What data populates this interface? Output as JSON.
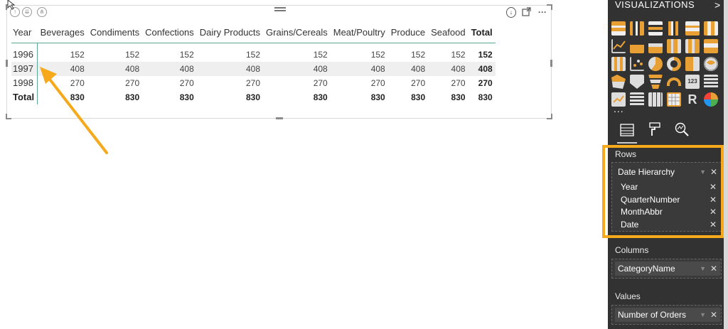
{
  "matrix": {
    "row_header": "Year",
    "columns": [
      "Beverages",
      "Condiments",
      "Confections",
      "Dairy Products",
      "Grains/Cereals",
      "Meat/Poultry",
      "Produce",
      "Seafood"
    ],
    "total_label": "Total",
    "rows": [
      {
        "year": "1996",
        "values": [
          "152",
          "152",
          "152",
          "152",
          "152",
          "152",
          "152",
          "152"
        ],
        "total": "152"
      },
      {
        "year": "1997",
        "values": [
          "408",
          "408",
          "408",
          "408",
          "408",
          "408",
          "408",
          "408"
        ],
        "total": "408"
      },
      {
        "year": "1998",
        "values": [
          "270",
          "270",
          "270",
          "270",
          "270",
          "270",
          "270",
          "270"
        ],
        "total": "270"
      }
    ],
    "grand_total": {
      "label": "Total",
      "values": [
        "830",
        "830",
        "830",
        "830",
        "830",
        "830",
        "830",
        "830"
      ],
      "total": "830"
    }
  },
  "visual_header": {
    "more_label": "···",
    "drill_up": "↑",
    "drill_down": "⇊",
    "expand": "⋔"
  },
  "panel": {
    "title": "VISUALIZATIONS",
    "chevron": ">",
    "more_label": "...",
    "r_label": "R",
    "rows_label": "Rows",
    "rows_field": "Date Hierarchy",
    "rows_levels": [
      "Year",
      "QuarterNumber",
      "MonthAbbr",
      "Date"
    ],
    "columns_label": "Columns",
    "columns_field": "CategoryName",
    "values_label": "Values",
    "values_field": "Number of Orders"
  },
  "colors": {
    "accent_teal": "#5aa697",
    "highlight": "#f5a91b",
    "panel_bg": "#323232"
  }
}
